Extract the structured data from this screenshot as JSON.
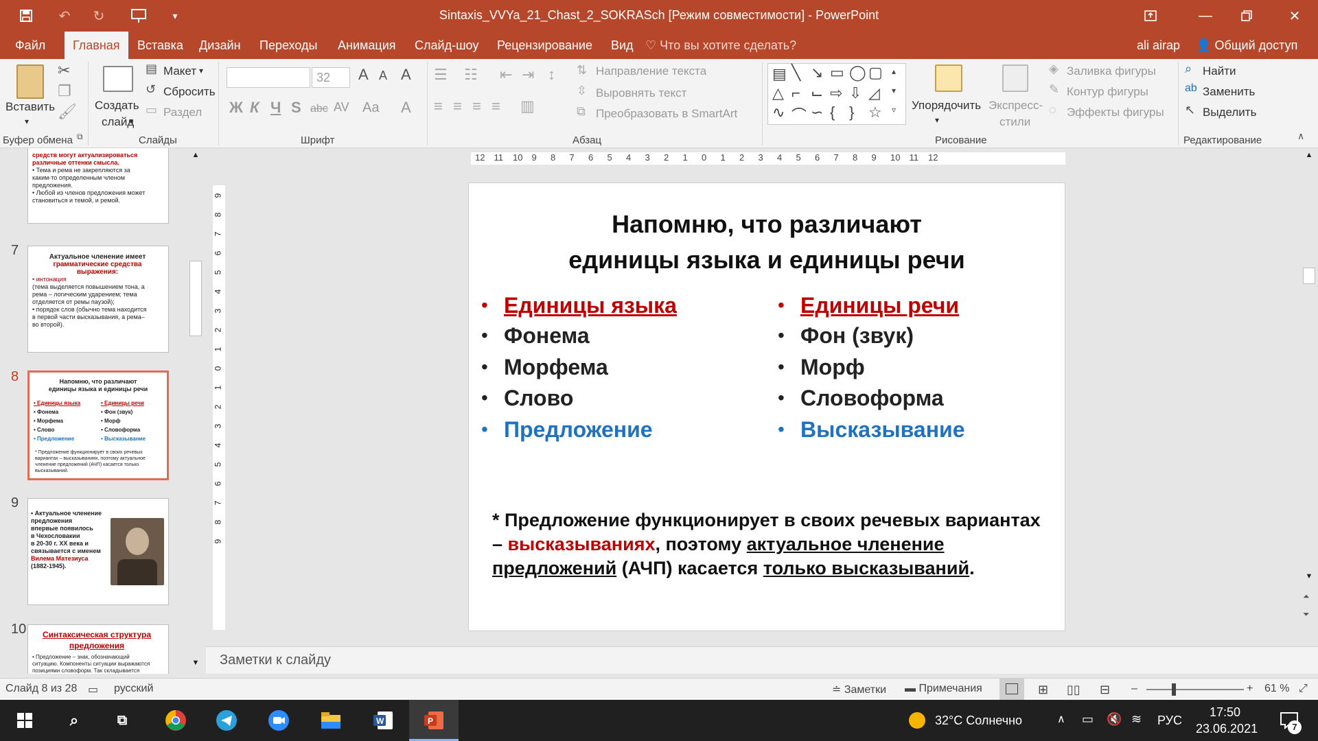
{
  "titlebar": {
    "document_title": "Sintaxis_VVYa_21_Chast_2_SOKRASch [Режим совместимости] - PowerPoint"
  },
  "tabs": {
    "items": [
      "Файл",
      "Главная",
      "Вставка",
      "Дизайн",
      "Переходы",
      "Анимация",
      "Слайд-шоу",
      "Рецензирование",
      "Вид"
    ],
    "active": "Главная",
    "tell_me": "Что вы хотите сделать?",
    "user": "ali airap",
    "share": "Общий доступ"
  },
  "ribbon": {
    "clipboard": {
      "paste": "Вставить",
      "label": "Буфер обмена"
    },
    "slides": {
      "new_slide_1": "Создать",
      "new_slide_2": "слайд",
      "layout": "Макет",
      "reset": "Сбросить",
      "section": "Раздел",
      "label": "Слайды"
    },
    "font": {
      "size": "32",
      "bold": "Ж",
      "italic": "К",
      "underline": "Ч",
      "shadow": "S",
      "strike": "abc",
      "spacing": "AV",
      "case": "Aa",
      "color": "A",
      "label": "Шрифт"
    },
    "paragraph": {
      "text_direction": "Направление текста",
      "align_text": "Выровнять текст",
      "smartart": "Преобразовать в SmartArt",
      "label": "Абзац"
    },
    "drawing": {
      "arrange": "Упорядочить",
      "quick_styles_1": "Экспресс-",
      "quick_styles_2": "стили",
      "fill": "Заливка фигуры",
      "outline": "Контур фигуры",
      "effects": "Эффекты фигуры",
      "label": "Рисование"
    },
    "editing": {
      "find": "Найти",
      "replace": "Заменить",
      "select": "Выделить",
      "label": "Редактирование"
    }
  },
  "thumbnails": [
    {
      "number": "",
      "lines": [
        "средств могут актуализироваться",
        "различные оттенки смысла.",
        "• Тема и рема не закрепляются за",
        "каким-то определенным членом",
        "предложения.",
        "• Любой из членов предложения может",
        "становиться и темой, и ремой."
      ]
    },
    {
      "number": "7",
      "lines": [
        "Актуальное членение имеет",
        "грамматические средства",
        "выражения:",
        "• интонация",
        "(тема выделяется повышением тона, а",
        "рема – логическим ударением; тема",
        "отделяется от ремы паузой);",
        "• порядок слов (обычно тема находится",
        "в первой части высказывания, а рема–",
        "во второй)."
      ]
    },
    {
      "number": "8",
      "title_lines": [
        "Напомню, что различают",
        "единицы языка и единицы речи"
      ],
      "left": [
        "Единицы языка",
        "Фонема",
        "Морфема",
        "Слово",
        "Предложение"
      ],
      "right": [
        "Единицы речи",
        "Фон (звук)",
        "Морф",
        "Словоформа",
        "Высказывание"
      ],
      "note_lines": [
        "* Предложение функционирует в своих речевых",
        "вариантах – высказываниях, поэтому актуальное",
        "членение предложений (АЧП) касается только",
        "высказываний."
      ]
    },
    {
      "number": "9",
      "lines": [
        "• Актуальное членение",
        "предложения",
        "впервые появилось",
        "в Чехословакии",
        "в 20-30 г. XX века и",
        "связывается с именем",
        "Вилема Матезиуса",
        "(1882-1945)."
      ]
    },
    {
      "number": "10",
      "title_lines": [
        "Синтаксическая структура",
        "предложения"
      ],
      "lines": [
        "• Предложение – знак, обозначающий",
        "ситуацию. Компоненты ситуации выражаются",
        "позициями словоформ. Так складывается"
      ]
    }
  ],
  "rulers": {
    "horizontal": [
      "12",
      "11",
      "10",
      "9",
      "8",
      "7",
      "6",
      "5",
      "4",
      "3",
      "2",
      "1",
      "0",
      "1",
      "2",
      "3",
      "4",
      "5",
      "6",
      "7",
      "8",
      "9",
      "10",
      "11",
      "12"
    ],
    "vertical": [
      "9",
      "8",
      "7",
      "6",
      "5",
      "4",
      "3",
      "2",
      "1",
      "0",
      "1",
      "2",
      "3",
      "4",
      "5",
      "6",
      "7",
      "8",
      "9"
    ]
  },
  "slide": {
    "title_line1": "Напомню, что различают",
    "title_line2": "единицы языка и единицы речи",
    "left_column": [
      {
        "text": "Единицы языка",
        "style": "red-underline"
      },
      {
        "text": "Фонема",
        "style": "black"
      },
      {
        "text": "Морфема",
        "style": "black"
      },
      {
        "text": "Слово",
        "style": "black"
      },
      {
        "text": "Предложение",
        "style": "blue"
      }
    ],
    "right_column": [
      {
        "text": "Единицы речи",
        "style": "red-underline"
      },
      {
        "text": "Фон (звук)",
        "style": "black"
      },
      {
        "text": "Морф",
        "style": "black"
      },
      {
        "text": "Словоформа",
        "style": "black"
      },
      {
        "text": "Высказывание",
        "style": "blue"
      }
    ],
    "note": {
      "p1": "* Предложение функционирует в своих речевых вариантах – ",
      "p2": "высказываниях",
      "p3": ", поэтому ",
      "p4": "актуальное членение предложений",
      "p5": " (АЧП) касается ",
      "p6": "только высказываний",
      "p7": "."
    },
    "colors": {
      "red": "#c00000",
      "blue": "#1f72c0",
      "bullet_red": "#c00000",
      "bullet_blue": "#1f72c0"
    }
  },
  "notes_placeholder": "Заметки к слайду",
  "statusbar": {
    "slide_counter": "Слайд 8 из 28",
    "language": "русский",
    "notes": "Заметки",
    "comments": "Примечания",
    "zoom_minus": "–",
    "zoom_plus": "+",
    "zoom": "61 %"
  },
  "taskbar": {
    "weather": "32°C  Солнечно",
    "lang": "РУС",
    "time": "17:50",
    "date": "23.06.2021",
    "notifications": "7"
  }
}
